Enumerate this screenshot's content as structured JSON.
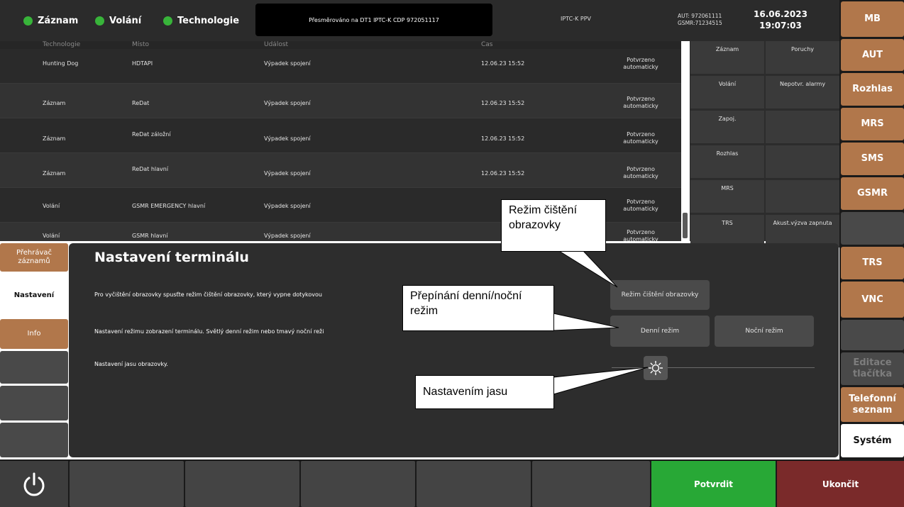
{
  "header": {
    "indicators": [
      {
        "label": "Záznam",
        "color": "#38b43a"
      },
      {
        "label": "Volání",
        "color": "#38b43a"
      },
      {
        "label": "Technologie",
        "color": "#38b43a"
      }
    ],
    "redirect_text": "Přesměrováno na DT1 IPTC-K CDP 972051117",
    "line_label": "IPTC-K PPV",
    "aut_id": "AUT: 972061111",
    "gsmr_id": "GSMR:71234515",
    "date": "16.06.2023",
    "time": "19:07:03"
  },
  "alarm_table": {
    "columns": [
      "Technologie",
      "Místo",
      "Událost",
      "Čas"
    ],
    "rows": [
      {
        "technology": "Hunting Dog",
        "place": "HDTAPI",
        "event": "Výpadek spojení",
        "time": "12.06.23 15:52",
        "status": "Potvrzeno automaticky"
      },
      {
        "technology": "Záznam",
        "place": "ReDat",
        "event": "Výpadek spojení",
        "time": "12.06.23 15:52",
        "status": "Potvrzeno automaticky"
      },
      {
        "technology": "Záznam",
        "place": "ReDat záložní",
        "event": "Výpadek spojení",
        "time": "12.06.23 15:52",
        "status": "Potvrzeno automaticky"
      },
      {
        "technology": "Záznam",
        "place": "ReDat hlavní",
        "event": "Výpadek spojení",
        "time": "12.06.23 15:52",
        "status": "Potvrzeno automaticky"
      },
      {
        "technology": "Volání",
        "place": "GSMR EMERGENCY hlavní",
        "event": "Výpadek spojení",
        "time": "",
        "status": "Potvrzeno automaticky"
      },
      {
        "technology": "Volání",
        "place": "GSMR hlavní",
        "event": "Výpadek spojení",
        "time": "",
        "status": "Potvrzeno automaticky"
      }
    ]
  },
  "filters": [
    "Záznam",
    "Poruchy",
    "Volání",
    "Nepotvr. alarmy",
    "Zapoj.",
    "",
    "Rozhlas",
    "",
    "MRS",
    "",
    "TRS",
    "Akust.výzva zapnuta"
  ],
  "right_menu": [
    {
      "label": "MB",
      "style": "brown"
    },
    {
      "label": "AUT",
      "style": "brown"
    },
    {
      "label": "Rozhlas",
      "style": "brown"
    },
    {
      "label": "MRS",
      "style": "brown"
    },
    {
      "label": "SMS",
      "style": "brown"
    },
    {
      "label": "GSMR",
      "style": "brown"
    },
    {
      "label": "",
      "style": "gray"
    },
    {
      "label": "TRS",
      "style": "brown"
    },
    {
      "label": "VNC",
      "style": "brown"
    },
    {
      "label": "",
      "style": "gray"
    },
    {
      "label": "Editace tlačítka",
      "style": "dim"
    },
    {
      "label": "Telefonní seznam",
      "style": "brown"
    },
    {
      "label": "Systém",
      "style": "white"
    }
  ],
  "left_tabs": [
    {
      "label": "Přehrávač záznamů",
      "style": "brown"
    },
    {
      "label": "Nastavení",
      "style": "white"
    },
    {
      "label": "Info",
      "style": "brown"
    },
    {
      "label": "",
      "style": "gray"
    },
    {
      "label": "",
      "style": "gray"
    },
    {
      "label": "",
      "style": "gray"
    }
  ],
  "settings": {
    "title": "Nastavení terminálu",
    "clean_text": "Pro vyčištění obrazovky spusťte režim čištění obrazovky, který vypne dotykovou",
    "mode_text": "Nastavení režimu zobrazení terminálu. Světlý denní režim nebo tmavý noční reži",
    "brightness_text": "Nastavení jasu obrazovky.",
    "clean_button": "Režim čištění obrazovky",
    "day_button": "Denní režim",
    "night_button": "Noční režim"
  },
  "bottom": {
    "confirm": "Potvrdit",
    "end": "Ukončit"
  },
  "callouts": {
    "clean": "Režim čištění obrazovky",
    "mode": "Přepínání denní/noční režim",
    "brightness": "Nastavením jasu"
  },
  "icons": {
    "power": "power-icon",
    "brightness": "sun-icon",
    "status_dot": "status-dot-icon"
  }
}
